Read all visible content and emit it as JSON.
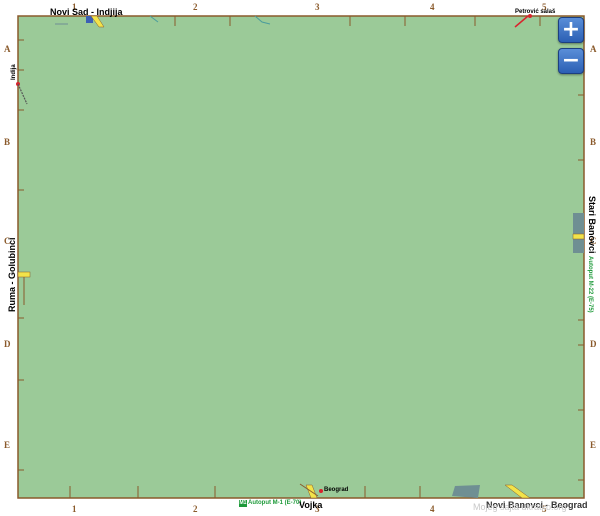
{
  "map": {
    "edge_labels": {
      "top_left": "Novi Sad - Indjija",
      "top_right": "Petrović salaš",
      "left_small": "Indija",
      "left": "Ruma - Golubinci",
      "right": "Stari Banovci",
      "right_road": "Autoput M-22 (E-75)",
      "bottom_road": "Autoput M-1 (E-70)",
      "bottom_road_badge": "M1",
      "bottom_center": "Vojka",
      "bottom_center_small": "Beograd",
      "bottom_right": "Novi Banovci - Beograd"
    },
    "columns": [
      "1",
      "2",
      "3",
      "4",
      "5"
    ],
    "rows": [
      "A",
      "B",
      "C",
      "D",
      "E"
    ],
    "watermark": "Mojeg sajta ukratko.org",
    "colors": {
      "land": "#9bca98",
      "border": "#8a5a2b",
      "road_yellow": "#f2e34a",
      "water": "#6f8f93",
      "marker_red": "#d9232d"
    }
  },
  "controls": {
    "zoom_in": "+",
    "zoom_out": "−"
  }
}
